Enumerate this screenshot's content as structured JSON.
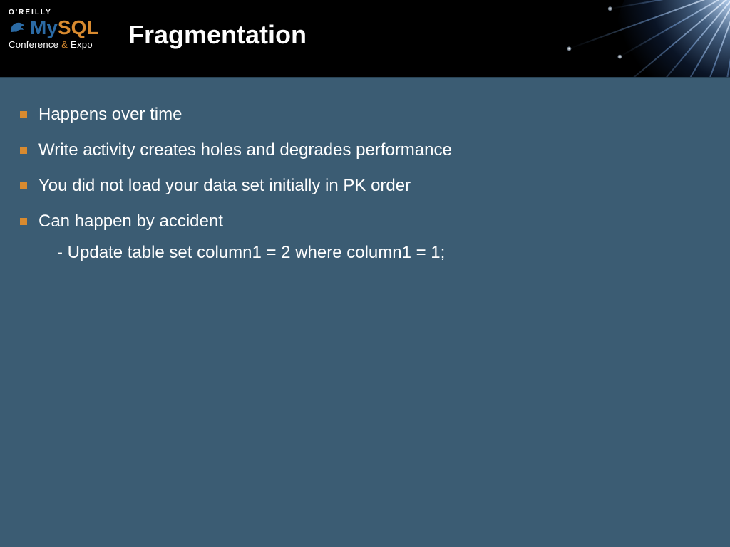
{
  "header": {
    "brand_top": "O'REILLY",
    "brand_mysql_my": "My",
    "brand_mysql_sql": "SQL",
    "brand_sub_a": "Conference ",
    "brand_sub_amp": "&",
    "brand_sub_b": " Expo",
    "title": "Fragmentation"
  },
  "bullets": [
    {
      "text": "Happens over time"
    },
    {
      "text": "Write activity creates holes and degrades performance"
    },
    {
      "text": "You did not load your data set initially in PK order"
    },
    {
      "text": "Can happen by accident",
      "sub": "- Update table set column1 = 2 where column1 = 1;"
    }
  ],
  "colors": {
    "background": "#3b5c73",
    "banner": "#000000",
    "accent": "#d88a2f",
    "text": "#ffffff"
  }
}
